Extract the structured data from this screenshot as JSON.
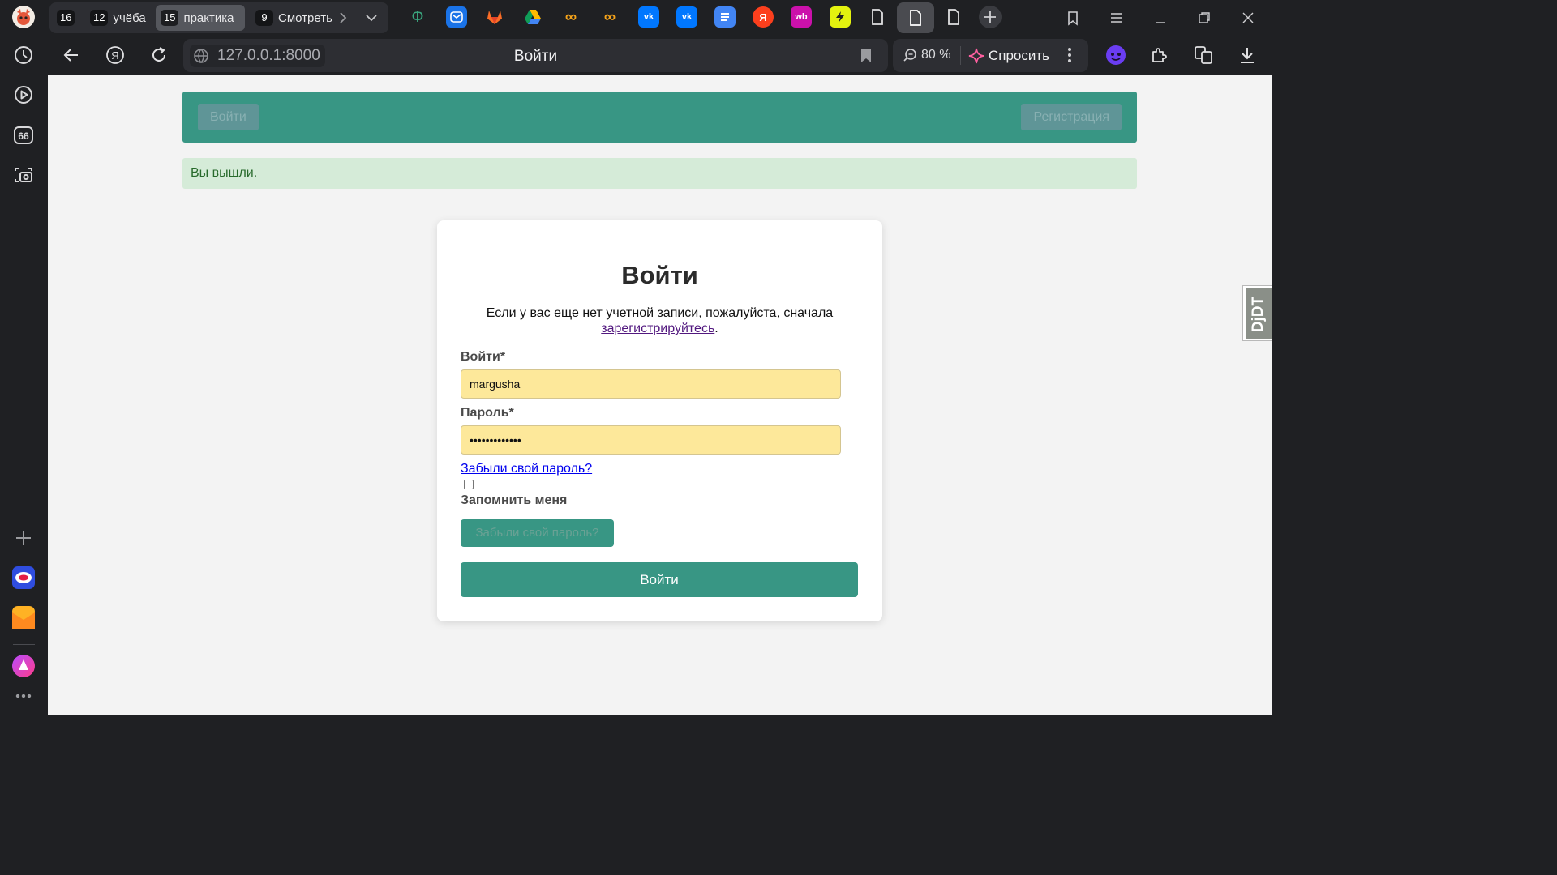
{
  "browser": {
    "tabs": [
      {
        "count": "16",
        "label": ""
      },
      {
        "count": "12",
        "label": "учёба"
      },
      {
        "count": "15",
        "label": "практика"
      },
      {
        "count": "9",
        "label": "Смотреть"
      }
    ],
    "url": "127.0.0.1:8000",
    "page_title": "Войти",
    "zoom": "80 %",
    "ask_label": "Спросить"
  },
  "nav": {
    "login": "Войти",
    "register": "Регистрация"
  },
  "alert": "Вы вышли.",
  "form": {
    "title": "Войти",
    "intro_text": "Если у вас еще нет учетной записи, пожалуйста, сначала",
    "register_link": "зарегистрируйтесь",
    "intro_end": ".",
    "login_label": "Войти*",
    "login_value": "margusha",
    "password_label": "Пароль*",
    "password_value": "•••••••••••••",
    "forgot_link": "Забыли свой пароль?",
    "remember_label": "Запомнить меня",
    "forgot_button": "Забыли свой пароль?",
    "submit": "Войти"
  },
  "djdt": "DjDT",
  "colors": {
    "accent": "#389684",
    "alert_bg": "#d5ebd8",
    "field_bg": "#fde89a",
    "browser_bg": "#1f2023"
  },
  "icons": {
    "sidebar": [
      "history-icon",
      "play-icon",
      "quote-icon",
      "screenshot-icon",
      "plus-icon",
      "opera-icon",
      "mail-icon",
      "alice-icon",
      "more-icon"
    ]
  }
}
